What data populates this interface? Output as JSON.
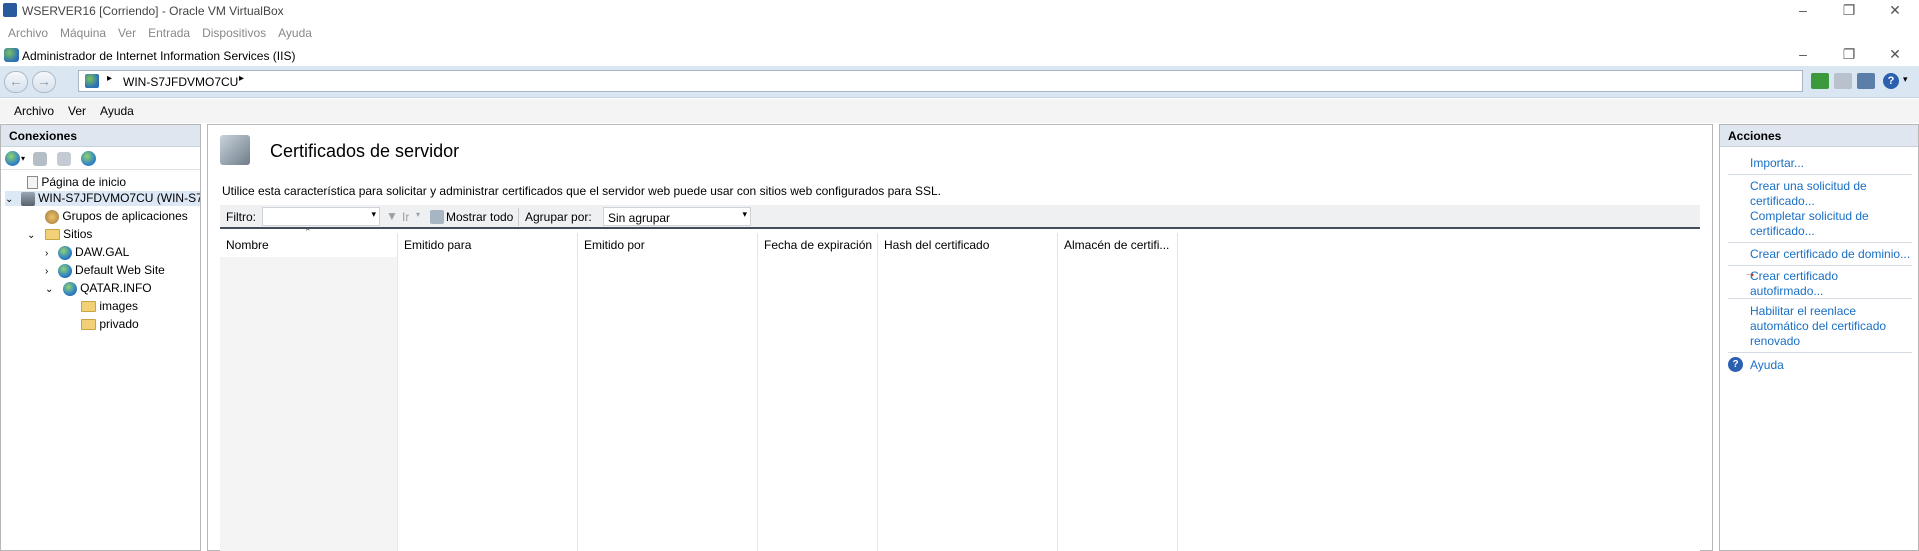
{
  "vbox": {
    "title": "WSERVER16 [Corriendo] - Oracle VM VirtualBox",
    "menu": [
      "Archivo",
      "Máquina",
      "Ver",
      "Entrada",
      "Dispositivos",
      "Ayuda"
    ]
  },
  "iis": {
    "title": "Administrador de Internet Information Services (IIS)",
    "address": "WIN-S7JFDVMO7CU",
    "menu": [
      "Archivo",
      "Ver",
      "Ayuda"
    ]
  },
  "connections": {
    "title": "Conexiones",
    "tree": {
      "start_page": "Página de inicio",
      "server": "WIN-S7JFDVMO7CU (WIN-S7",
      "app_pools": "Grupos de aplicaciones",
      "sites": "Sitios",
      "site1": "DAW.GAL",
      "site2": "Default Web Site",
      "site3": "QATAR.INFO",
      "folder1": "images",
      "folder2": "privado"
    }
  },
  "main": {
    "title": "Certificados de servidor",
    "description": "Utilice esta característica para solicitar y administrar certificados que el servidor web puede usar con sitios web configurados para SSL.",
    "filter_label": "Filtro:",
    "go_label": "Ir",
    "show_all_label": "Mostrar todo",
    "group_by_label": "Agrupar por:",
    "group_by_value": "Sin agrupar",
    "columns": [
      "Nombre",
      "Emitido para",
      "Emitido por",
      "Fecha de expiración",
      "Hash del certificado",
      "Almacén de certifi..."
    ]
  },
  "actions": {
    "title": "Acciones",
    "import": "Importar...",
    "create_request_1": "Crear una solicitud de",
    "create_request_2": "certificado...",
    "complete_request_1": "Completar solicitud de",
    "complete_request_2": "certificado...",
    "domain_cert": "Crear certificado de dominio...",
    "self_signed_1": "Crear certificado",
    "self_signed_2": "autofirmado...",
    "rebind_1": "Habilitar el reenlace",
    "rebind_2": "automático del certificado",
    "rebind_3": "renovado",
    "help": "Ayuda"
  }
}
